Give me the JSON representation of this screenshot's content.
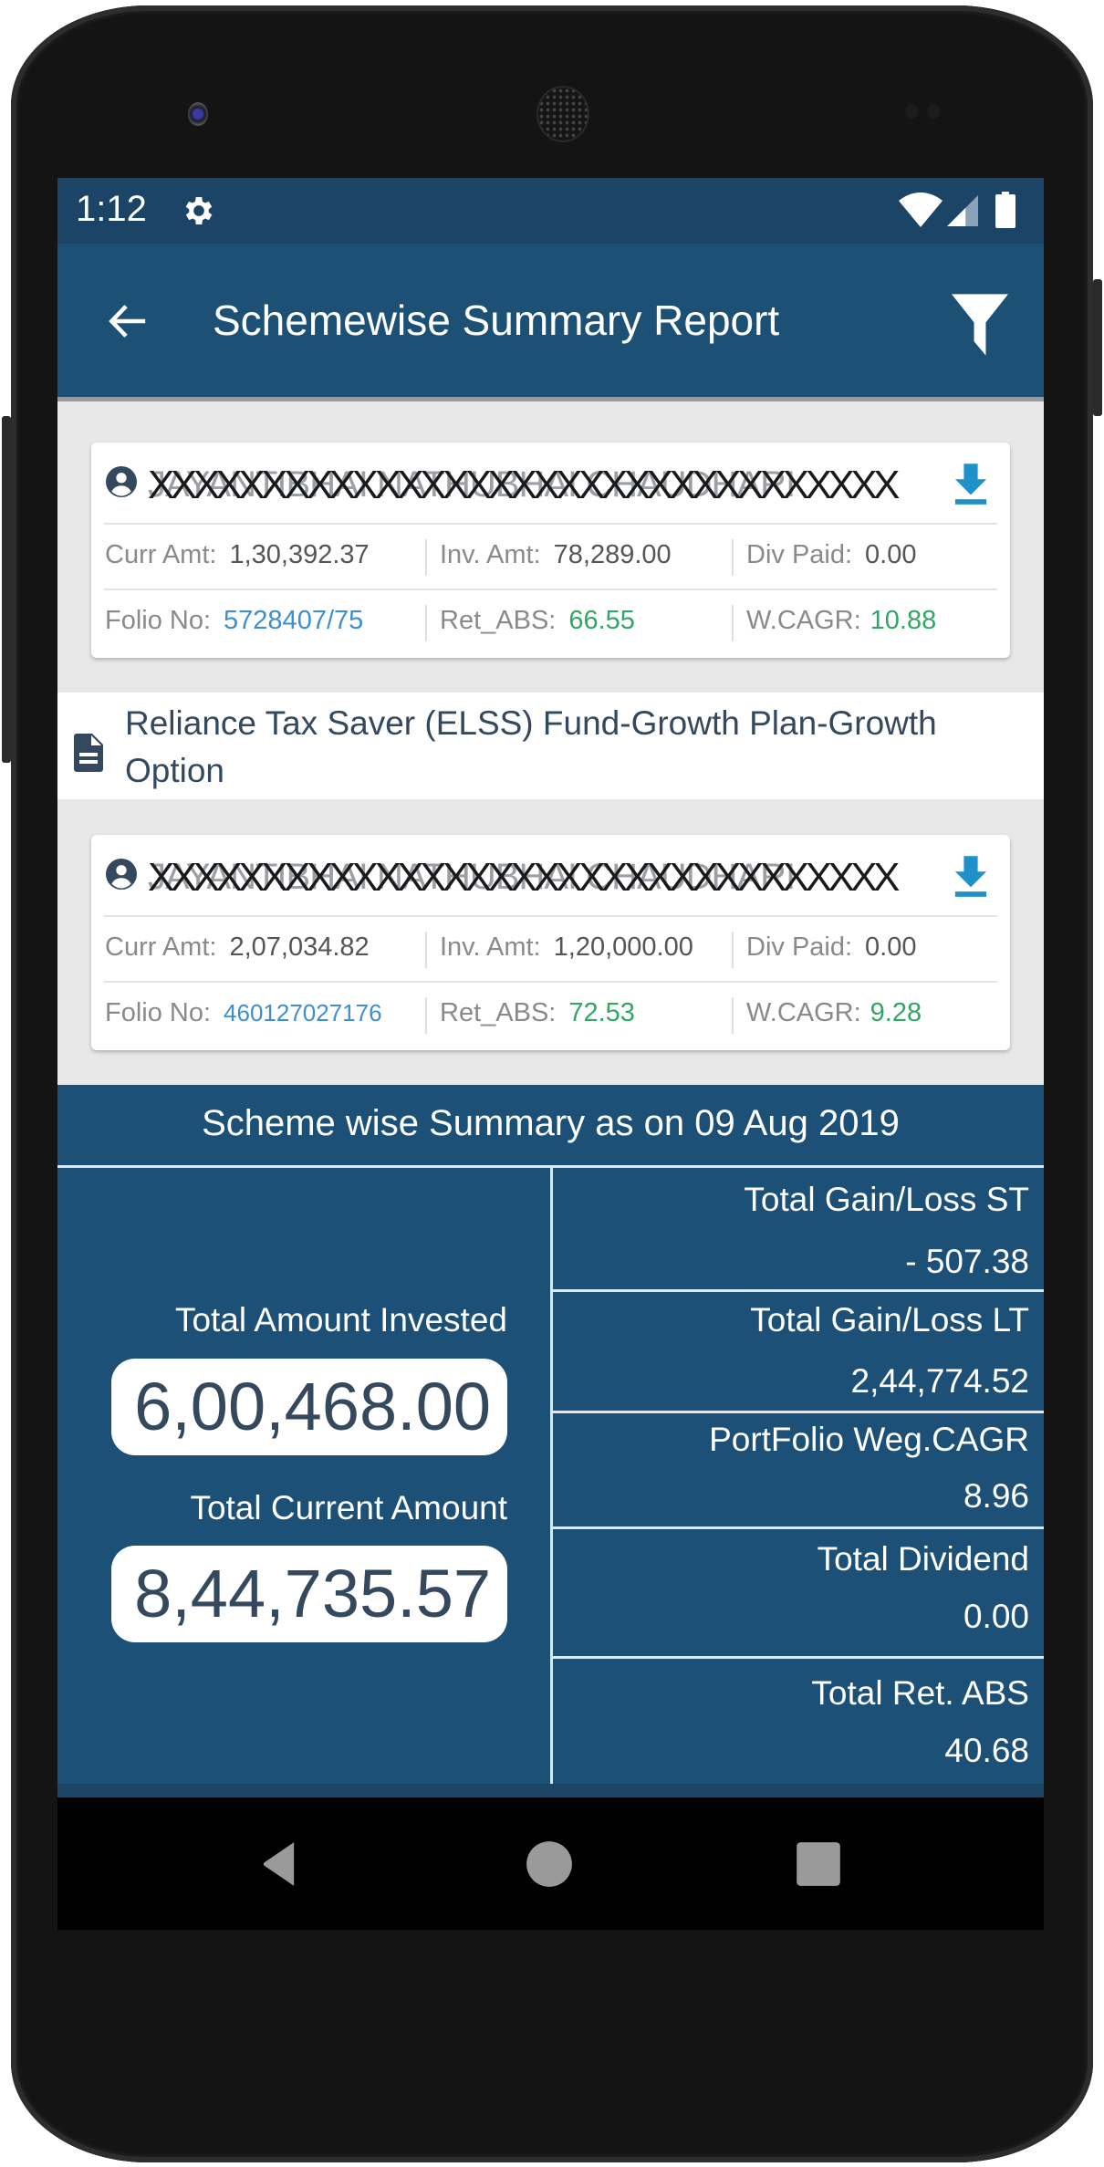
{
  "status_bar": {
    "time": "1:12",
    "icons": [
      "gear-icon",
      "wifi-icon",
      "signal-icon",
      "battery-icon"
    ]
  },
  "app_bar": {
    "title": "Schemewise Summary Report",
    "back_icon": "arrow-left-icon",
    "filter_icon": "filter-icon"
  },
  "folios": [
    {
      "investor_name_masked": "XXXXXXXXXXXXXXXXXXXXXXXXXXXXXXXXX",
      "investor_name_underlying": "JAYANTIBHAI NATHUBHAI CHAUDHARI",
      "curr_amt_label": "Curr Amt:",
      "curr_amt": "1,30,392.37",
      "inv_amt_label": "Inv. Amt:",
      "inv_amt": "78,289.00",
      "div_paid_label": "Div Paid:",
      "div_paid": "0.00",
      "folio_label": "Folio No:",
      "folio_no": "5728407/75",
      "ret_abs_label": "Ret_ABS:",
      "ret_abs": "66.55",
      "wcagr_label": "W.CAGR:",
      "wcagr": "10.88"
    },
    {
      "investor_name_masked": "XXXXXXXXXXXXXXXXXXXXXXXXXXXXXXXXX",
      "investor_name_underlying": "JAYANTIBHAI NATHUBHAI CHAUDHARI",
      "curr_amt_label": "Curr Amt:",
      "curr_amt": "2,07,034.82",
      "inv_amt_label": "Inv. Amt:",
      "inv_amt": "1,20,000.00",
      "div_paid_label": "Div Paid:",
      "div_paid": "0.00",
      "folio_label": "Folio No:",
      "folio_no": "460127027176",
      "ret_abs_label": "Ret_ABS:",
      "ret_abs": "72.53",
      "wcagr_label": "W.CAGR:",
      "wcagr": "9.28"
    }
  ],
  "scheme": {
    "name": "Reliance Tax Saver (ELSS) Fund-Growth Plan-Growth Option"
  },
  "summary": {
    "heading": "Scheme wise Summary as on 09 Aug 2019",
    "total_invested_label": "Total Amount Invested",
    "total_invested": "6,00,468.00",
    "total_current_label": "Total Current Amount",
    "total_current": "8,44,735.57",
    "stats": [
      {
        "label": "Total Gain/Loss ST",
        "value": "- 507.38"
      },
      {
        "label": "Total Gain/Loss LT",
        "value": "2,44,774.52"
      },
      {
        "label": "PortFolio Weg.CAGR",
        "value": "8.96"
      },
      {
        "label": "Total Dividend",
        "value": "0.00"
      },
      {
        "label": "Total Ret. ABS",
        "value": "40.68"
      }
    ]
  },
  "nav_bar": {
    "buttons": [
      "back-icon",
      "home-icon",
      "recents-icon"
    ]
  },
  "colors": {
    "status_bar": "#1b4466",
    "app_bar": "#1c5075",
    "summary_bg": "#1d5076",
    "download_accent": "#2090c8",
    "folio_link": "#3d8fd1",
    "positive": "#2fa866",
    "text_dark": "#34495e"
  }
}
